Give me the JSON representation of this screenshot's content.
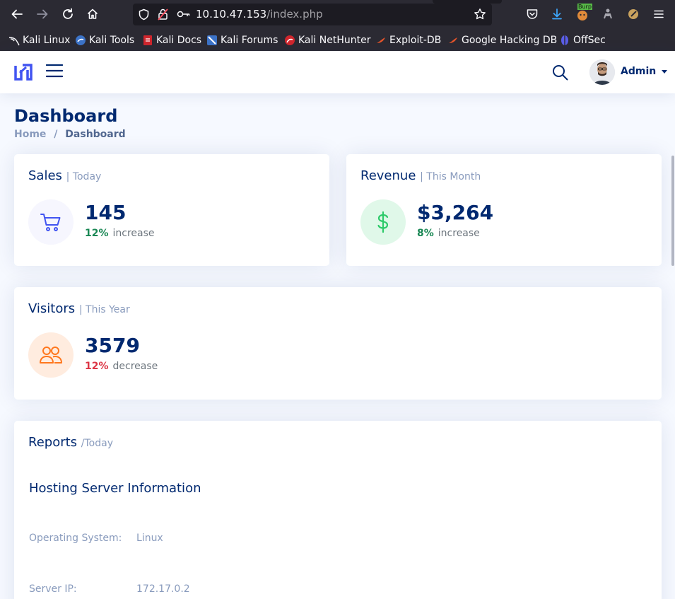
{
  "browser": {
    "url_host": "10.10.47.153",
    "url_path": "/index.php",
    "burp_badge": "Burp"
  },
  "bookmarks": [
    {
      "label": "Kali Linux",
      "icon": "kali-dragon-icon"
    },
    {
      "label": "Kali Tools",
      "icon": "kali-tools-icon"
    },
    {
      "label": "Kali Docs",
      "icon": "kali-docs-icon"
    },
    {
      "label": "Kali Forums",
      "icon": "kali-forums-icon"
    },
    {
      "label": "Kali NetHunter",
      "icon": "nethunter-icon"
    },
    {
      "label": "Exploit-DB",
      "icon": "exploitdb-icon"
    },
    {
      "label": "Google Hacking DB",
      "icon": "ghdb-icon"
    },
    {
      "label": "OffSec",
      "icon": "offsec-icon"
    }
  ],
  "header": {
    "user_name": "Admin"
  },
  "page": {
    "title": "Dashboard",
    "breadcrumb_home": "Home",
    "breadcrumb_separator": "/",
    "breadcrumb_current": "Dashboard"
  },
  "cards": {
    "sales": {
      "title": "Sales",
      "period": "| Today",
      "value": "145",
      "change_pct": "12%",
      "change_label": "increase",
      "color": "#2eca6a",
      "icon": "cart-icon"
    },
    "revenue": {
      "title": "Revenue",
      "period": "| This Month",
      "value": "$3,264",
      "change_pct": "8%",
      "change_label": "increase",
      "color": "#2eca6a",
      "icon": "dollar-icon"
    },
    "visitors": {
      "title": "Visitors",
      "period": "| This Year",
      "value": "3579",
      "change_pct": "12%",
      "change_label": "decrease",
      "color": "#dc3545",
      "icon": "people-icon"
    }
  },
  "reports": {
    "title": "Reports",
    "period": "/Today",
    "section_title": "Hosting Server Information",
    "rows": [
      {
        "label": "Operating System:",
        "value": "Linux"
      },
      {
        "label": "Server IP:",
        "value": "172.17.0.2"
      }
    ]
  },
  "colors": {
    "primary": "#012970",
    "muted": "#899bbd",
    "accent": "#4154f1",
    "success": "#198754",
    "danger": "#dc3545"
  }
}
